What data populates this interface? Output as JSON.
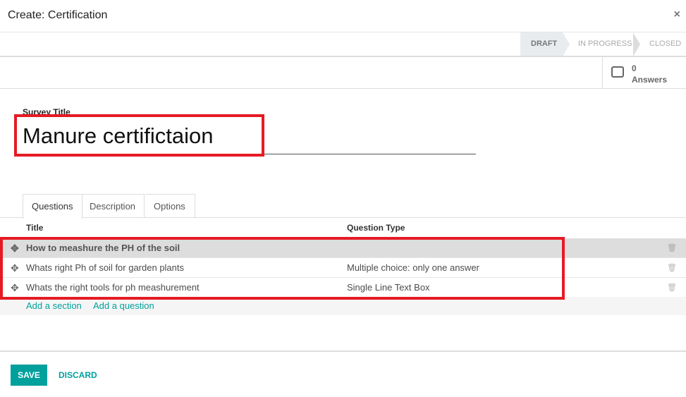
{
  "dialog": {
    "title": "Create: Certification",
    "close": "×"
  },
  "status": {
    "stages": [
      "DRAFT",
      "IN PROGRESS",
      "CLOSED"
    ],
    "active": "DRAFT"
  },
  "answers": {
    "count": "0",
    "label": "Answers"
  },
  "form": {
    "label": "Survey Title",
    "title": "Manure certifictaion"
  },
  "tabs": [
    "Questions",
    "Description",
    "Options"
  ],
  "table": {
    "headers": [
      "Title",
      "Question Type"
    ],
    "rows": [
      {
        "title": "How to meashure the PH of the soil",
        "type": "",
        "section": true
      },
      {
        "title": "Whats right Ph of soil for garden plants",
        "type": "Multiple choice: only one answer"
      },
      {
        "title": "Whats the right tools for ph meashurement",
        "type": "Single Line Text Box"
      }
    ],
    "add_section": "Add a section",
    "add_question": "Add a question"
  },
  "footer": {
    "save": "SAVE",
    "discard": "DISCARD"
  },
  "colors": {
    "accent": "#00a09d",
    "highlight": "#e51b24"
  }
}
